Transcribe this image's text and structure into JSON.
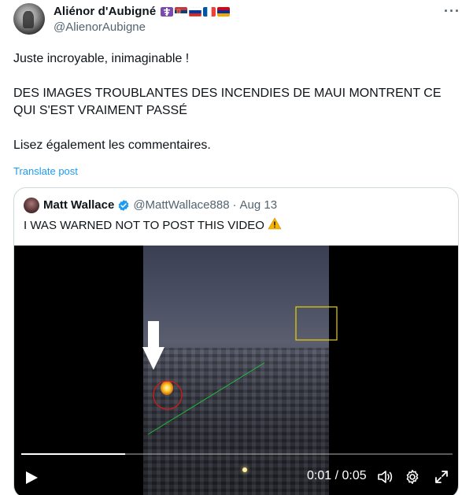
{
  "author": {
    "display_name": "Aliénor d'Aubigné",
    "handle": "@AlienorAubigne",
    "flag_icons": [
      "orthodox-cross-icon",
      "serbia-flag-icon",
      "russia-flag-icon",
      "france-flag-icon",
      "armenia-flag-icon"
    ]
  },
  "more_icon": "more-icon",
  "post": {
    "line1": "Juste incroyable, inimaginable !",
    "line2": "DES IMAGES TROUBLANTES DES INCENDIES DE MAUI MONTRENT CE QUI S'EST VRAIMENT PASSÉ",
    "line3": "Lisez également les commentaires.",
    "translate": "Translate post"
  },
  "quote": {
    "display_name": "Matt Wallace",
    "handle": "@MattWallace888",
    "separator": "·",
    "date": "Aug 13",
    "text": "I WAS WARNED NOT TO POST THIS VIDEO",
    "warning_icon": "⚠️"
  },
  "video": {
    "time": "0:01 / 0:05",
    "progress": 0.24,
    "controls": [
      "play-icon",
      "volume-icon",
      "settings-icon",
      "fullscreen-icon"
    ]
  },
  "colors": {
    "link": "#1d9bf0",
    "secondary_text": "#536471",
    "annotation_yellow": "#e8d200",
    "annotation_red": "#d11a1a",
    "annotation_green": "#1fbf3a"
  }
}
